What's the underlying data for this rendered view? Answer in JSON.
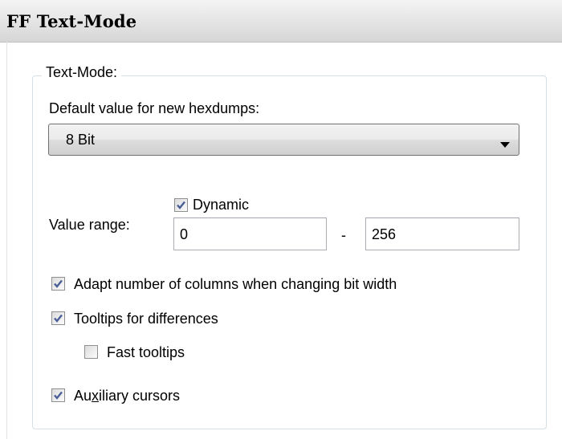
{
  "header": {
    "title": "FF Text-Mode"
  },
  "group": {
    "legend": "Text-Mode:",
    "default_label": "Default value for new hexdumps:",
    "dropdown": {
      "value": "8 Bit"
    },
    "value_range": {
      "label": "Value range:",
      "dynamic": {
        "label": "Dynamic",
        "checked": true
      },
      "min": "0",
      "separator": "-",
      "max": "256"
    },
    "options": {
      "adapt_columns": {
        "label": "Adapt number of columns when changing bit width",
        "checked": true
      },
      "tooltips": {
        "label": "Tooltips for differences",
        "checked": true
      },
      "fast_tooltips": {
        "label": "Fast tooltips",
        "checked": false
      },
      "auxiliary": {
        "label_pre": "Au",
        "label_underlined": "x",
        "label_post": "iliary cursors",
        "checked": true
      }
    }
  },
  "colors": {
    "checkmark": "#4a5f97",
    "group_border": "#d5dfe5",
    "header_top": "#f4f4f4",
    "header_bottom": "#d6d6d6"
  },
  "icons": {
    "dropdown_arrow": "chevron-down-icon",
    "checkmark": "checkmark-icon"
  }
}
